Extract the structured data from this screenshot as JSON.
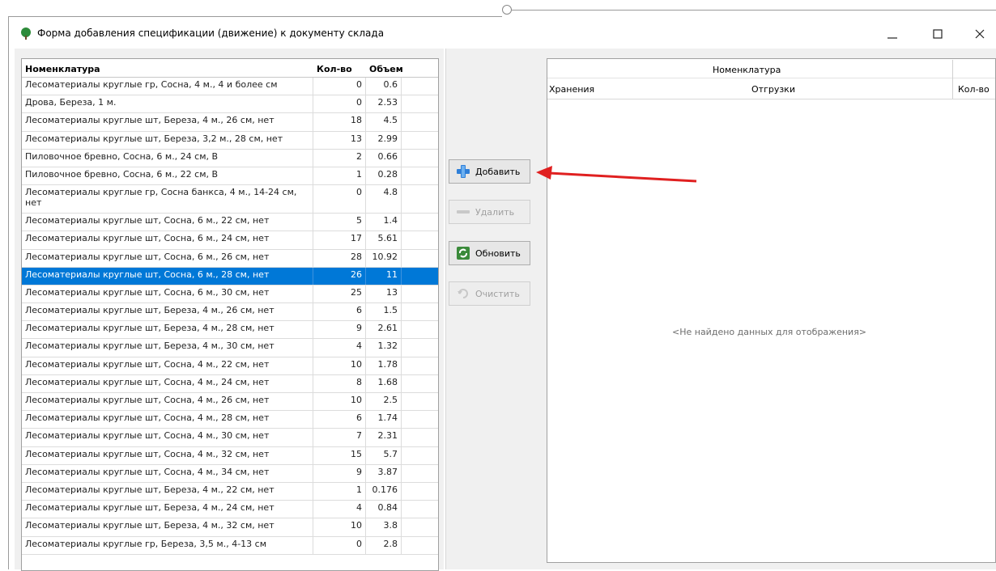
{
  "window": {
    "title": "Форма добавления спецификации (движение) к документу склада",
    "controls": {
      "minimize": "—",
      "maximize": "☐",
      "close": "✕"
    }
  },
  "left_grid": {
    "columns": [
      "Номенклатура",
      "Кол-во",
      "Объем"
    ],
    "rows": [
      [
        "Лесоматериалы круглые гр, Сосна, 4 м., 4 и более см",
        "0",
        "0.6"
      ],
      [
        "Дрова, Береза, 1 м.",
        "0",
        "2.53"
      ],
      [
        "Лесоматериалы круглые шт, Береза, 4 м., 26 см, нет",
        "18",
        "4.5"
      ],
      [
        "Лесоматериалы круглые шт, Береза, 3,2 м., 28 см, нет",
        "13",
        "2.99"
      ],
      [
        "Пиловочное бревно, Сосна, 6 м., 24 см, В",
        "2",
        "0.66"
      ],
      [
        "Пиловочное бревно, Сосна, 6 м., 22 см, В",
        "1",
        "0.28"
      ],
      [
        "Лесоматериалы круглые гр, Сосна банкса, 4 м., 14-24 см, нет",
        "0",
        "4.8"
      ],
      [
        "Лесоматериалы круглые шт, Сосна, 6 м., 22 см, нет",
        "5",
        "1.4"
      ],
      [
        "Лесоматериалы круглые шт, Сосна, 6 м., 24 см, нет",
        "17",
        "5.61"
      ],
      [
        "Лесоматериалы круглые шт, Сосна, 6 м., 26 см, нет",
        "28",
        "10.92"
      ],
      [
        "Лесоматериалы круглые шт, Сосна, 6 м., 28 см, нет",
        "26",
        "11"
      ],
      [
        "Лесоматериалы круглые шт, Сосна, 6 м., 30 см, нет",
        "25",
        "13"
      ],
      [
        "Лесоматериалы круглые шт, Береза, 4 м., 26 см, нет",
        "6",
        "1.5"
      ],
      [
        "Лесоматериалы круглые шт, Береза, 4 м., 28 см, нет",
        "9",
        "2.61"
      ],
      [
        "Лесоматериалы круглые шт, Береза, 4 м., 30 см, нет",
        "4",
        "1.32"
      ],
      [
        "Лесоматериалы круглые шт, Сосна, 4 м., 22 см, нет",
        "10",
        "1.78"
      ],
      [
        "Лесоматериалы круглые шт, Сосна, 4 м., 24 см, нет",
        "8",
        "1.68"
      ],
      [
        "Лесоматериалы круглые шт, Сосна, 4 м., 26 см, нет",
        "10",
        "2.5"
      ],
      [
        "Лесоматериалы круглые шт, Сосна, 4 м., 28 см, нет",
        "6",
        "1.74"
      ],
      [
        "Лесоматериалы круглые шт, Сосна, 4 м., 30 см, нет",
        "7",
        "2.31"
      ],
      [
        "Лесоматериалы круглые шт, Сосна, 4 м., 32 см, нет",
        "15",
        "5.7"
      ],
      [
        "Лесоматериалы круглые шт, Сосна, 4 м., 34 см, нет",
        "9",
        "3.87"
      ],
      [
        "Лесоматериалы круглые шт, Береза, 4 м., 22 см, нет",
        "1",
        "0.176"
      ],
      [
        "Лесоматериалы круглые шт, Береза, 4 м., 24 см, нет",
        "4",
        "0.84"
      ],
      [
        "Лесоматериалы круглые шт, Береза, 4 м., 32 см, нет",
        "10",
        "3.8"
      ],
      [
        "Лесоматериалы круглые гр, Береза, 3,5 м., 4-13 см",
        "0",
        "2.8"
      ]
    ],
    "selected_row": 10
  },
  "buttons": {
    "add": "Добавить",
    "delete": "Удалить",
    "refresh": "Обновить",
    "clear": "Очистить"
  },
  "right_grid": {
    "band_header": "Номенклатура",
    "columns": [
      "Хранения",
      "Отгрузки",
      "Кол-во"
    ],
    "empty_text": "<Не найдено данных для отображения>"
  },
  "colors": {
    "selection": "#0078d7",
    "arrow": "#e02020",
    "add_icon": "#2f7fd8",
    "refresh_icon": "#3a8a3a"
  }
}
